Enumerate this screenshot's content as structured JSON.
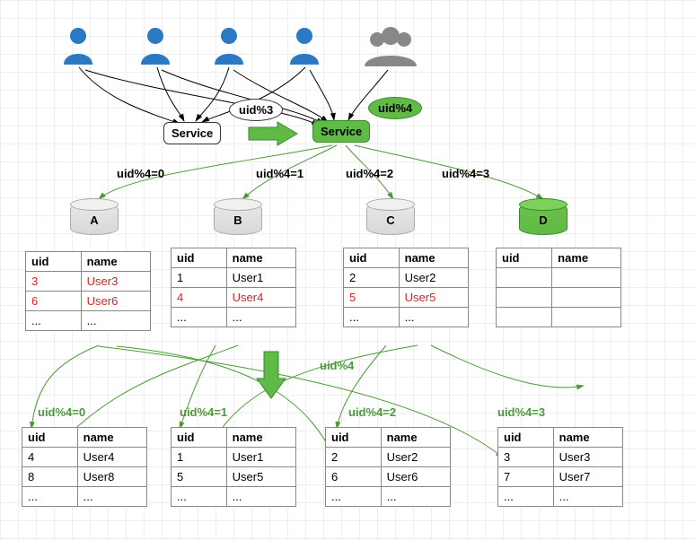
{
  "speech1": "uid%3",
  "speech2": "uid%4",
  "service1": "Service",
  "service2": "Service",
  "midArrowLabel": "uid%4",
  "edgesTop": {
    "e0": "uid%4=0",
    "e1": "uid%4=1",
    "e2": "uid%4=2",
    "e3": "uid%4=3"
  },
  "dbs": {
    "a": "A",
    "b": "B",
    "c": "C",
    "d": "D"
  },
  "tablesTop": {
    "A": {
      "headers": [
        "uid",
        "name"
      ],
      "rows": [
        [
          "3",
          "User3",
          "red"
        ],
        [
          "6",
          "User6",
          "red"
        ],
        [
          "...",
          "...",
          ""
        ]
      ]
    },
    "B": {
      "headers": [
        "uid",
        "name"
      ],
      "rows": [
        [
          "1",
          "User1",
          ""
        ],
        [
          "4",
          "User4",
          "red"
        ],
        [
          "...",
          "...",
          ""
        ]
      ]
    },
    "C": {
      "headers": [
        "uid",
        "name"
      ],
      "rows": [
        [
          "2",
          "User2",
          ""
        ],
        [
          "5",
          "User5",
          "red"
        ],
        [
          "...",
          "...",
          ""
        ]
      ]
    },
    "D": {
      "headers": [
        "uid",
        "name"
      ],
      "rows": [
        [
          "",
          "",
          ""
        ],
        [
          "",
          "",
          ""
        ],
        [
          "",
          "",
          ""
        ]
      ]
    }
  },
  "edgesBottom": {
    "e0": "uid%4=0",
    "e1": "uid%4=1",
    "e2": "uid%4=2",
    "e3": "uid%4=3"
  },
  "tablesBottom": {
    "T0": {
      "headers": [
        "uid",
        "name"
      ],
      "rows": [
        [
          "4",
          "User4"
        ],
        [
          "8",
          "User8"
        ],
        [
          "...",
          "..."
        ]
      ]
    },
    "T1": {
      "headers": [
        "uid",
        "name"
      ],
      "rows": [
        [
          "1",
          "User1"
        ],
        [
          "5",
          "User5"
        ],
        [
          "...",
          "..."
        ]
      ]
    },
    "T2": {
      "headers": [
        "uid",
        "name"
      ],
      "rows": [
        [
          "2",
          "User2"
        ],
        [
          "6",
          "User6"
        ],
        [
          "...",
          "..."
        ]
      ]
    },
    "T3": {
      "headers": [
        "uid",
        "name"
      ],
      "rows": [
        [
          "3",
          "User3"
        ],
        [
          "7",
          "User7"
        ],
        [
          "...",
          "..."
        ]
      ]
    }
  },
  "colors": {
    "green": "#5fbb46",
    "greenDark": "#3a8a2a",
    "red": "#d22"
  }
}
